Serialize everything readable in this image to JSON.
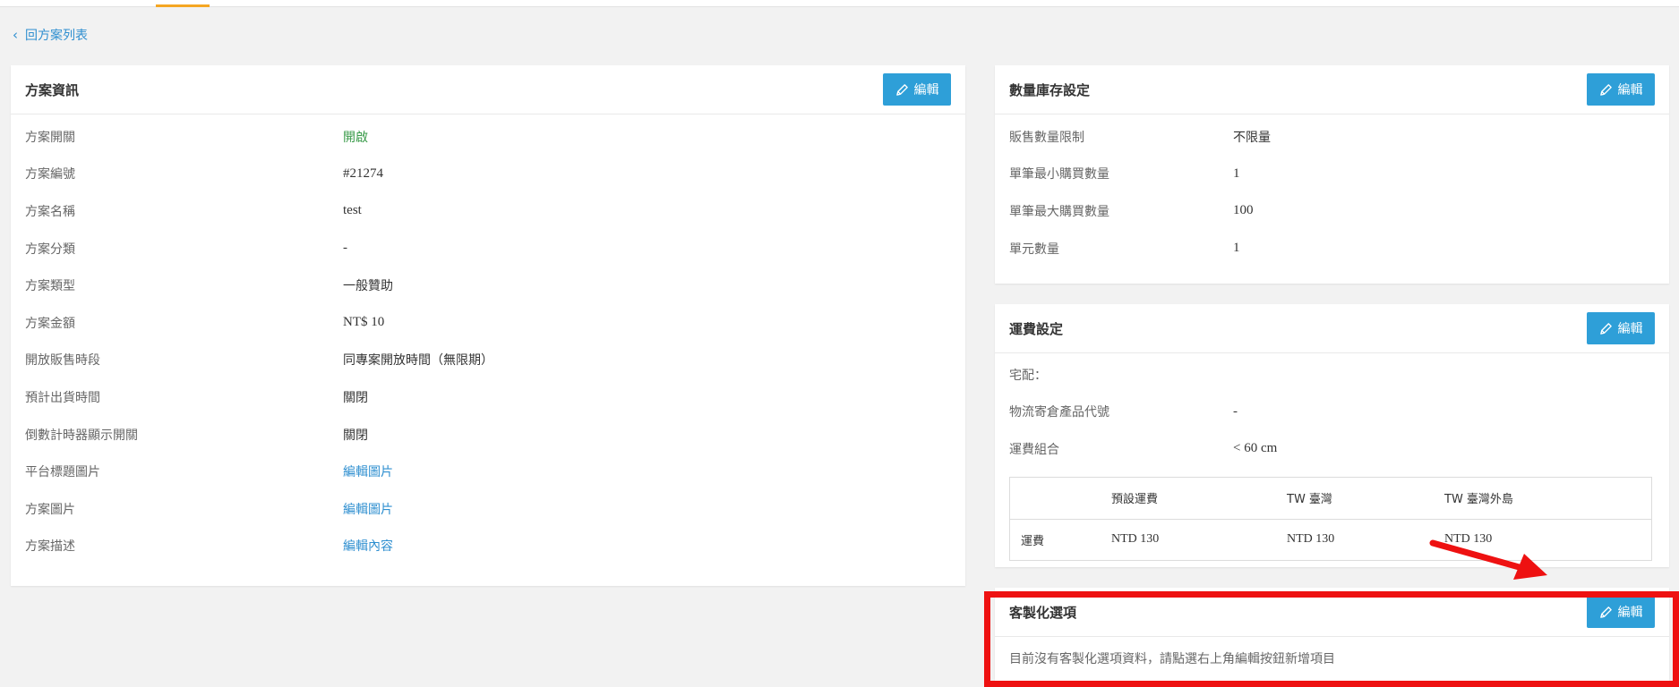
{
  "nav": {
    "back_label": "回方案列表"
  },
  "common": {
    "edit_label": "編輯"
  },
  "plan_info": {
    "title": "方案資訊",
    "rows": [
      {
        "key": "方案開關",
        "value": "開啟"
      },
      {
        "key": "方案編號",
        "value": "#21274"
      },
      {
        "key": "方案名稱",
        "value": "test"
      },
      {
        "key": "方案分類",
        "value": "-"
      },
      {
        "key": "方案類型",
        "value": "一般贊助"
      },
      {
        "key": "方案金額",
        "value": "NT$ 10"
      },
      {
        "key": "開放販售時段",
        "value": "同專案開放時間（無限期）"
      },
      {
        "key": "預計出貨時間",
        "value": "關閉"
      },
      {
        "key": "倒數計時器顯示開關",
        "value": "關閉"
      },
      {
        "key": "平台標題圖片",
        "value": "編輯圖片"
      },
      {
        "key": "方案圖片",
        "value": "編輯圖片"
      },
      {
        "key": "方案描述",
        "value": "編輯內容"
      }
    ]
  },
  "stock": {
    "title": "數量庫存設定",
    "rows": [
      {
        "key": "販售數量限制",
        "value": "不限量"
      },
      {
        "key": "單筆最小購買數量",
        "value": "1"
      },
      {
        "key": "單筆最大購買數量",
        "value": "100"
      },
      {
        "key": "單元數量",
        "value": "1"
      }
    ]
  },
  "shipping": {
    "title": "運費設定",
    "rows": [
      {
        "key": "宅配：",
        "value": ""
      },
      {
        "key": "物流寄倉產品代號",
        "value": "-"
      },
      {
        "key": "運費組合",
        "value": "< 60 cm"
      }
    ],
    "table": {
      "headers": [
        "",
        "預設運費",
        "TW 臺灣",
        "TW 臺灣外島"
      ],
      "row": [
        "運費",
        "NTD 130",
        "NTD 130",
        "NTD 130"
      ]
    }
  },
  "custom": {
    "title": "客製化選項",
    "empty_message": "目前沒有客製化選項資料，請點選右上角編輯按鈕新增項目"
  },
  "annotation": {
    "frame_color": "#ee1111",
    "arrow_color": "#ee1111"
  },
  "colors": {
    "accent": "#2e9fd8",
    "link": "#2f8fd0",
    "status_on": "#3a9b4a",
    "tab_underline": "#f5a623"
  }
}
